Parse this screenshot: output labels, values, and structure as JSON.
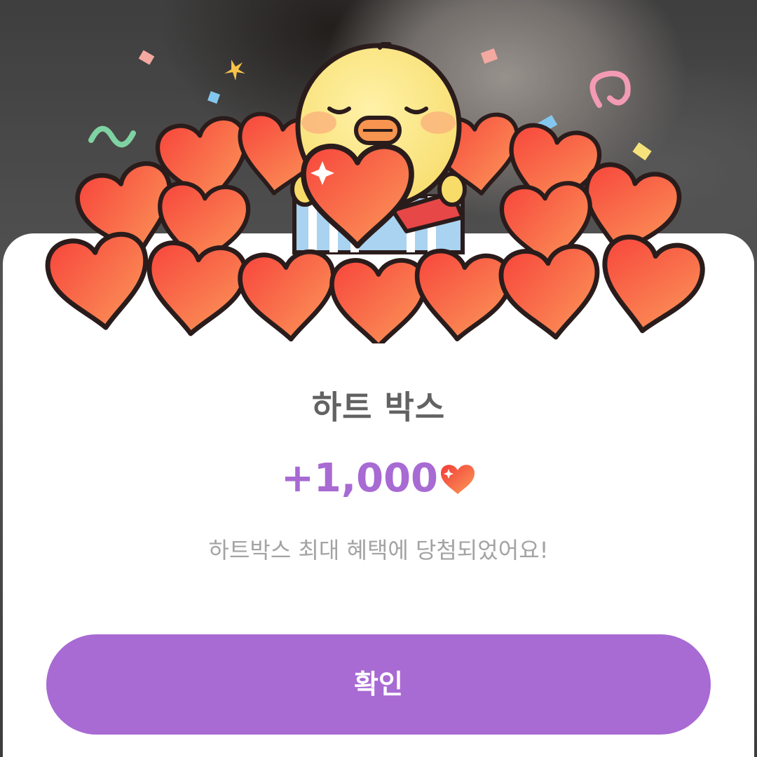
{
  "dialog": {
    "title": "하트 박스",
    "reward_amount": "+1,000",
    "reward_icon": "heart-icon",
    "message": "하트박스 최대 혜택에 당첨되었어요!",
    "confirm_label": "확인"
  },
  "illustration": {
    "subject": "chick-holding-heart-icon",
    "decoration": "heart-pile-icon"
  },
  "colors": {
    "accent": "#a86ad3",
    "title": "#626262",
    "message": "#a3a3a3",
    "heart": "#f2553a"
  }
}
